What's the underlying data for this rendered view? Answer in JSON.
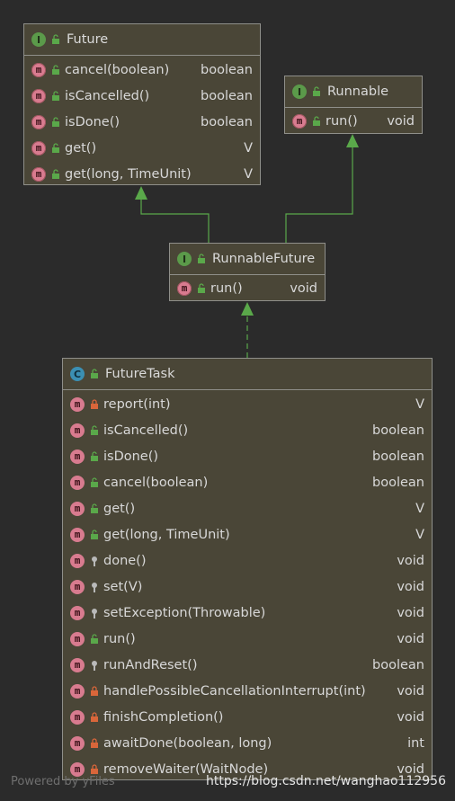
{
  "future": {
    "title": "Future",
    "kind_badge": "I",
    "methods": [
      {
        "name": "cancel(boolean)",
        "type": "boolean"
      },
      {
        "name": "isCancelled()",
        "type": "boolean"
      },
      {
        "name": "isDone()",
        "type": "boolean"
      },
      {
        "name": "get()",
        "type": "V"
      },
      {
        "name": "get(long, TimeUnit)",
        "type": "V"
      }
    ]
  },
  "runnable": {
    "title": "Runnable",
    "kind_badge": "I",
    "methods": [
      {
        "name": "run()",
        "type": "void"
      }
    ]
  },
  "runnable_future": {
    "title": "RunnableFuture",
    "kind_badge": "I",
    "methods": [
      {
        "name": "run()",
        "type": "void"
      }
    ]
  },
  "future_task": {
    "title": "FutureTask",
    "kind_badge": "C",
    "methods": [
      {
        "name": "report(int)",
        "type": "V",
        "visibility": "private"
      },
      {
        "name": "isCancelled()",
        "type": "boolean",
        "visibility": "public"
      },
      {
        "name": "isDone()",
        "type": "boolean",
        "visibility": "public"
      },
      {
        "name": "cancel(boolean)",
        "type": "boolean",
        "visibility": "public"
      },
      {
        "name": "get()",
        "type": "V",
        "visibility": "public"
      },
      {
        "name": "get(long, TimeUnit)",
        "type": "V",
        "visibility": "public"
      },
      {
        "name": "done()",
        "type": "void",
        "visibility": "protected"
      },
      {
        "name": "set(V)",
        "type": "void",
        "visibility": "protected"
      },
      {
        "name": "setException(Throwable)",
        "type": "void",
        "visibility": "protected"
      },
      {
        "name": "run()",
        "type": "void",
        "visibility": "public"
      },
      {
        "name": "runAndReset()",
        "type": "boolean",
        "visibility": "protected"
      },
      {
        "name": "handlePossibleCancellationInterrupt(int)",
        "type": "void",
        "visibility": "private"
      },
      {
        "name": "finishCompletion()",
        "type": "void",
        "visibility": "private"
      },
      {
        "name": "awaitDone(boolean, long)",
        "type": "int",
        "visibility": "private"
      },
      {
        "name": "removeWaiter(WaitNode)",
        "type": "void",
        "visibility": "private"
      }
    ]
  },
  "method_badge": "m",
  "footer": {
    "powered": "Powered by yFiles",
    "url": "https://blog.csdn.net/wanghao112956"
  },
  "colors": {
    "background": "#2b2b2b",
    "box_fill": "#4a4637",
    "edge": "#5aa84a",
    "public_lock": "#5aa84a",
    "private_lock": "#d9663a",
    "protected_key": "#b9b9b9"
  }
}
